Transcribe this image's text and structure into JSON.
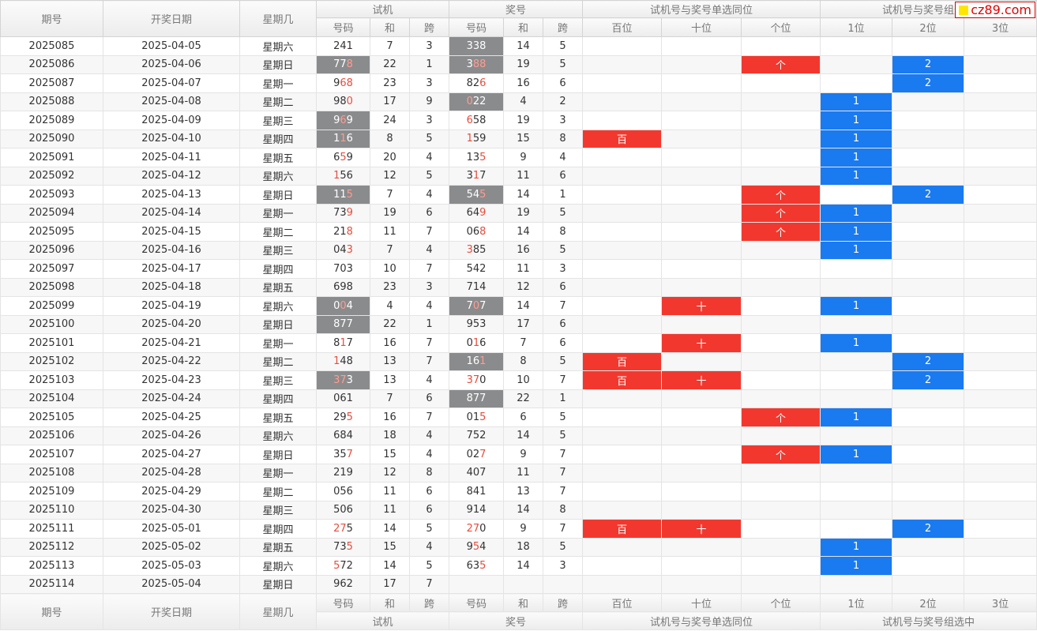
{
  "header": {
    "period": "期号",
    "date": "开奖日期",
    "weekday": "星期几",
    "test_group": "试机",
    "prize_group": "奖号",
    "same_pos_group": "试机号与奖号单选同位",
    "group_hit": "试机号与奖号组选中",
    "sub": {
      "code": "号码",
      "sum": "和",
      "span": "跨",
      "hundreds": "百位",
      "tens": "十位",
      "units": "个位",
      "pos1": "1位",
      "pos2": "2位",
      "pos3": "3位"
    }
  },
  "logo": {
    "text": "cz89.com",
    "color": "#d00000"
  },
  "colors": {
    "grey": "#8a8b8d",
    "red": "#f2382e",
    "blue": "#1a7af0"
  },
  "rows": [
    {
      "period": "2025085",
      "date": "2025-04-05",
      "weekday": "星期六",
      "t": "241",
      "ts": "7",
      "tk": "3",
      "p": "338",
      "ps": "14",
      "pk": "5",
      "tg": false,
      "pg": true,
      "tr": "",
      "pr": "",
      "h": "",
      "s": "",
      "g": "",
      "b1": "",
      "b2": "",
      "b3": ""
    },
    {
      "period": "2025086",
      "date": "2025-04-06",
      "weekday": "星期日",
      "t": "778",
      "ts": "22",
      "tk": "1",
      "p": "388",
      "ps": "19",
      "pk": "5",
      "tg": true,
      "pg": true,
      "tr": "8",
      "pr": "88",
      "h": "",
      "s": "",
      "g": "个",
      "b1": "",
      "b2": "2",
      "b3": ""
    },
    {
      "period": "2025087",
      "date": "2025-04-07",
      "weekday": "星期一",
      "t": "968",
      "ts": "23",
      "tk": "3",
      "p": "826",
      "ps": "16",
      "pk": "6",
      "tg": false,
      "pg": false,
      "tr": "68",
      "pr": "6",
      "h": "",
      "s": "",
      "g": "",
      "b1": "",
      "b2": "2",
      "b3": ""
    },
    {
      "period": "2025088",
      "date": "2025-04-08",
      "weekday": "星期二",
      "t": "980",
      "ts": "17",
      "tk": "9",
      "p": "022",
      "ps": "4",
      "pk": "2",
      "tg": false,
      "pg": true,
      "tr": "0",
      "pr": "0",
      "h": "",
      "s": "",
      "g": "",
      "b1": "1",
      "b2": "",
      "b3": ""
    },
    {
      "period": "2025089",
      "date": "2025-04-09",
      "weekday": "星期三",
      "t": "969",
      "ts": "24",
      "tk": "3",
      "p": "658",
      "ps": "19",
      "pk": "3",
      "tg": true,
      "pg": false,
      "tr": "6",
      "pr": "6",
      "h": "",
      "s": "",
      "g": "",
      "b1": "1",
      "b2": "",
      "b3": ""
    },
    {
      "period": "2025090",
      "date": "2025-04-10",
      "weekday": "星期四",
      "t": "116",
      "ts": "8",
      "tk": "5",
      "p": "159",
      "ps": "15",
      "pk": "8",
      "tg": true,
      "pg": false,
      "tr": "1",
      "pr": "1",
      "h": "百",
      "s": "",
      "g": "",
      "b1": "1",
      "b2": "",
      "b3": ""
    },
    {
      "period": "2025091",
      "date": "2025-04-11",
      "weekday": "星期五",
      "t": "659",
      "ts": "20",
      "tk": "4",
      "p": "135",
      "ps": "9",
      "pk": "4",
      "tg": false,
      "pg": false,
      "tr": "5",
      "pr": "5",
      "h": "",
      "s": "",
      "g": "",
      "b1": "1",
      "b2": "",
      "b3": ""
    },
    {
      "period": "2025092",
      "date": "2025-04-12",
      "weekday": "星期六",
      "t": "156",
      "ts": "12",
      "tk": "5",
      "p": "317",
      "ps": "11",
      "pk": "6",
      "tg": false,
      "pg": false,
      "tr": "1",
      "pr": "1",
      "h": "",
      "s": "",
      "g": "",
      "b1": "1",
      "b2": "",
      "b3": ""
    },
    {
      "period": "2025093",
      "date": "2025-04-13",
      "weekday": "星期日",
      "t": "115",
      "ts": "7",
      "tk": "4",
      "p": "545",
      "ps": "14",
      "pk": "1",
      "tg": true,
      "pg": true,
      "tr": "5",
      "pr": "5",
      "h": "",
      "s": "",
      "g": "个",
      "b1": "",
      "b2": "2",
      "b3": ""
    },
    {
      "period": "2025094",
      "date": "2025-04-14",
      "weekday": "星期一",
      "t": "739",
      "ts": "19",
      "tk": "6",
      "p": "649",
      "ps": "19",
      "pk": "5",
      "tg": false,
      "pg": false,
      "tr": "9",
      "pr": "9",
      "h": "",
      "s": "",
      "g": "个",
      "b1": "1",
      "b2": "",
      "b3": ""
    },
    {
      "period": "2025095",
      "date": "2025-04-15",
      "weekday": "星期二",
      "t": "218",
      "ts": "11",
      "tk": "7",
      "p": "068",
      "ps": "14",
      "pk": "8",
      "tg": false,
      "pg": false,
      "tr": "8",
      "pr": "8",
      "h": "",
      "s": "",
      "g": "个",
      "b1": "1",
      "b2": "",
      "b3": ""
    },
    {
      "period": "2025096",
      "date": "2025-04-16",
      "weekday": "星期三",
      "t": "043",
      "ts": "7",
      "tk": "4",
      "p": "385",
      "ps": "16",
      "pk": "5",
      "tg": false,
      "pg": false,
      "tr": "3",
      "pr": "3",
      "h": "",
      "s": "",
      "g": "",
      "b1": "1",
      "b2": "",
      "b3": ""
    },
    {
      "period": "2025097",
      "date": "2025-04-17",
      "weekday": "星期四",
      "t": "703",
      "ts": "10",
      "tk": "7",
      "p": "542",
      "ps": "11",
      "pk": "3",
      "tg": false,
      "pg": false,
      "tr": "",
      "pr": "",
      "h": "",
      "s": "",
      "g": "",
      "b1": "",
      "b2": "",
      "b3": ""
    },
    {
      "period": "2025098",
      "date": "2025-04-18",
      "weekday": "星期五",
      "t": "698",
      "ts": "23",
      "tk": "3",
      "p": "714",
      "ps": "12",
      "pk": "6",
      "tg": false,
      "pg": false,
      "tr": "",
      "pr": "",
      "h": "",
      "s": "",
      "g": "",
      "b1": "",
      "b2": "",
      "b3": ""
    },
    {
      "period": "2025099",
      "date": "2025-04-19",
      "weekday": "星期六",
      "t": "004",
      "ts": "4",
      "tk": "4",
      "p": "707",
      "ps": "14",
      "pk": "7",
      "tg": true,
      "pg": true,
      "tr": "0",
      "pr": "0",
      "h": "",
      "s": "十",
      "g": "",
      "b1": "1",
      "b2": "",
      "b3": ""
    },
    {
      "period": "2025100",
      "date": "2025-04-20",
      "weekday": "星期日",
      "t": "877",
      "ts": "22",
      "tk": "1",
      "p": "953",
      "ps": "17",
      "pk": "6",
      "tg": true,
      "pg": false,
      "tr": "",
      "pr": "",
      "h": "",
      "s": "",
      "g": "",
      "b1": "",
      "b2": "",
      "b3": ""
    },
    {
      "period": "2025101",
      "date": "2025-04-21",
      "weekday": "星期一",
      "t": "817",
      "ts": "16",
      "tk": "7",
      "p": "016",
      "ps": "7",
      "pk": "6",
      "tg": false,
      "pg": false,
      "tr": "1",
      "pr": "1",
      "h": "",
      "s": "十",
      "g": "",
      "b1": "1",
      "b2": "",
      "b3": ""
    },
    {
      "period": "2025102",
      "date": "2025-04-22",
      "weekday": "星期二",
      "t": "148",
      "ts": "13",
      "tk": "7",
      "p": "161",
      "ps": "8",
      "pk": "5",
      "tg": false,
      "pg": true,
      "tr": "1",
      "pr": "1",
      "h": "百",
      "s": "",
      "g": "",
      "b1": "",
      "b2": "2",
      "b3": ""
    },
    {
      "period": "2025103",
      "date": "2025-04-23",
      "weekday": "星期三",
      "t": "373",
      "ts": "13",
      "tk": "4",
      "p": "370",
      "ps": "10",
      "pk": "7",
      "tg": true,
      "pg": false,
      "tr": "37",
      "pr": "37",
      "h": "百",
      "s": "十",
      "g": "",
      "b1": "",
      "b2": "2",
      "b3": ""
    },
    {
      "period": "2025104",
      "date": "2025-04-24",
      "weekday": "星期四",
      "t": "061",
      "ts": "7",
      "tk": "6",
      "p": "877",
      "ps": "22",
      "pk": "1",
      "tg": false,
      "pg": true,
      "tr": "",
      "pr": "",
      "h": "",
      "s": "",
      "g": "",
      "b1": "",
      "b2": "",
      "b3": ""
    },
    {
      "period": "2025105",
      "date": "2025-04-25",
      "weekday": "星期五",
      "t": "295",
      "ts": "16",
      "tk": "7",
      "p": "015",
      "ps": "6",
      "pk": "5",
      "tg": false,
      "pg": false,
      "tr": "5",
      "pr": "5",
      "h": "",
      "s": "",
      "g": "个",
      "b1": "1",
      "b2": "",
      "b3": ""
    },
    {
      "period": "2025106",
      "date": "2025-04-26",
      "weekday": "星期六",
      "t": "684",
      "ts": "18",
      "tk": "4",
      "p": "752",
      "ps": "14",
      "pk": "5",
      "tg": false,
      "pg": false,
      "tr": "",
      "pr": "",
      "h": "",
      "s": "",
      "g": "",
      "b1": "",
      "b2": "",
      "b3": ""
    },
    {
      "period": "2025107",
      "date": "2025-04-27",
      "weekday": "星期日",
      "t": "357",
      "ts": "15",
      "tk": "4",
      "p": "027",
      "ps": "9",
      "pk": "7",
      "tg": false,
      "pg": false,
      "tr": "7",
      "pr": "7",
      "h": "",
      "s": "",
      "g": "个",
      "b1": "1",
      "b2": "",
      "b3": ""
    },
    {
      "period": "2025108",
      "date": "2025-04-28",
      "weekday": "星期一",
      "t": "219",
      "ts": "12",
      "tk": "8",
      "p": "407",
      "ps": "11",
      "pk": "7",
      "tg": false,
      "pg": false,
      "tr": "",
      "pr": "",
      "h": "",
      "s": "",
      "g": "",
      "b1": "",
      "b2": "",
      "b3": ""
    },
    {
      "period": "2025109",
      "date": "2025-04-29",
      "weekday": "星期二",
      "t": "056",
      "ts": "11",
      "tk": "6",
      "p": "841",
      "ps": "13",
      "pk": "7",
      "tg": false,
      "pg": false,
      "tr": "",
      "pr": "",
      "h": "",
      "s": "",
      "g": "",
      "b1": "",
      "b2": "",
      "b3": ""
    },
    {
      "period": "2025110",
      "date": "2025-04-30",
      "weekday": "星期三",
      "t": "506",
      "ts": "11",
      "tk": "6",
      "p": "914",
      "ps": "14",
      "pk": "8",
      "tg": false,
      "pg": false,
      "tr": "",
      "pr": "",
      "h": "",
      "s": "",
      "g": "",
      "b1": "",
      "b2": "",
      "b3": ""
    },
    {
      "period": "2025111",
      "date": "2025-05-01",
      "weekday": "星期四",
      "t": "275",
      "ts": "14",
      "tk": "5",
      "p": "270",
      "ps": "9",
      "pk": "7",
      "tg": false,
      "pg": false,
      "tr": "27",
      "pr": "27",
      "h": "百",
      "s": "十",
      "g": "",
      "b1": "",
      "b2": "2",
      "b3": ""
    },
    {
      "period": "2025112",
      "date": "2025-05-02",
      "weekday": "星期五",
      "t": "735",
      "ts": "15",
      "tk": "4",
      "p": "954",
      "ps": "18",
      "pk": "5",
      "tg": false,
      "pg": false,
      "tr": "5",
      "pr": "5",
      "h": "",
      "s": "",
      "g": "",
      "b1": "1",
      "b2": "",
      "b3": ""
    },
    {
      "period": "2025113",
      "date": "2025-05-03",
      "weekday": "星期六",
      "t": "572",
      "ts": "14",
      "tk": "5",
      "p": "635",
      "ps": "14",
      "pk": "3",
      "tg": false,
      "pg": false,
      "tr": "5",
      "pr": "5",
      "h": "",
      "s": "",
      "g": "",
      "b1": "1",
      "b2": "",
      "b3": ""
    },
    {
      "period": "2025114",
      "date": "2025-05-04",
      "weekday": "星期日",
      "t": "962",
      "ts": "17",
      "tk": "7",
      "p": "",
      "ps": "",
      "pk": "",
      "tg": false,
      "pg": false,
      "tr": "",
      "pr": "",
      "h": "",
      "s": "",
      "g": "",
      "b1": "",
      "b2": "",
      "b3": ""
    }
  ]
}
